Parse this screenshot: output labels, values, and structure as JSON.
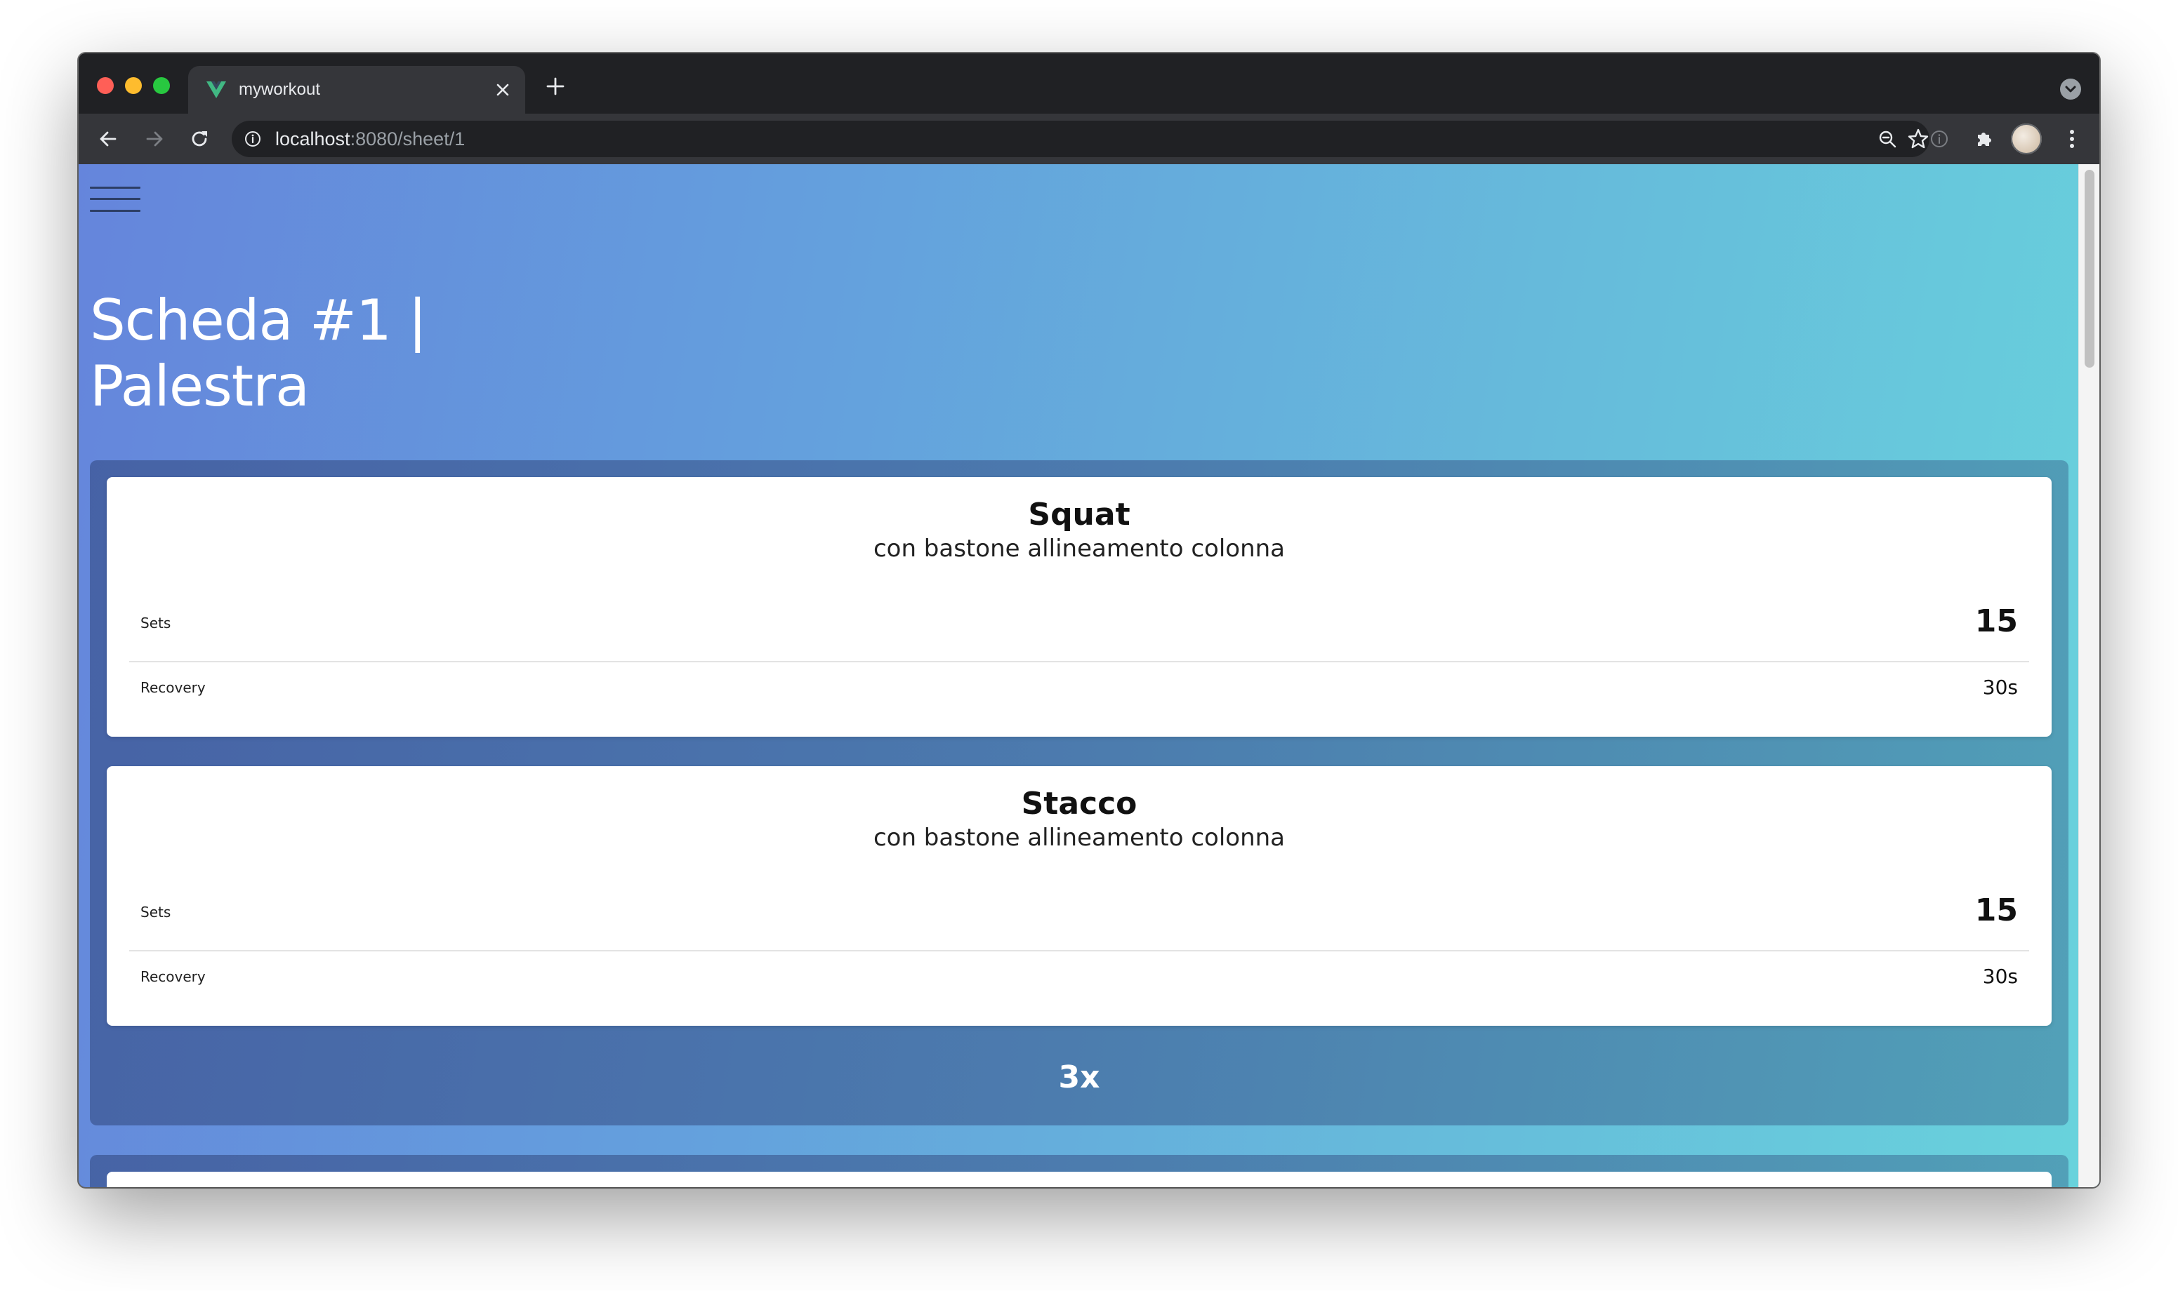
{
  "browser": {
    "tab_title": "myworkout",
    "url_host": "localhost",
    "url_rest": ":8080/sheet/1"
  },
  "page": {
    "title": "Scheda #1 | Palestra"
  },
  "exercises": [
    {
      "name": "Squat",
      "description": "con bastone allineamento colonna",
      "sets_label": "Sets",
      "sets_value": "15",
      "recovery_label": "Recovery",
      "recovery_value": "30s"
    },
    {
      "name": "Stacco",
      "description": "con bastone allineamento colonna",
      "sets_label": "Sets",
      "sets_value": "15",
      "recovery_label": "Recovery",
      "recovery_value": "30s"
    }
  ],
  "circuit": {
    "repeat": "3x"
  },
  "colors": {
    "gradient_start": "#6585dc",
    "gradient_end": "#68d3dc",
    "vue_green": "#41b883"
  }
}
